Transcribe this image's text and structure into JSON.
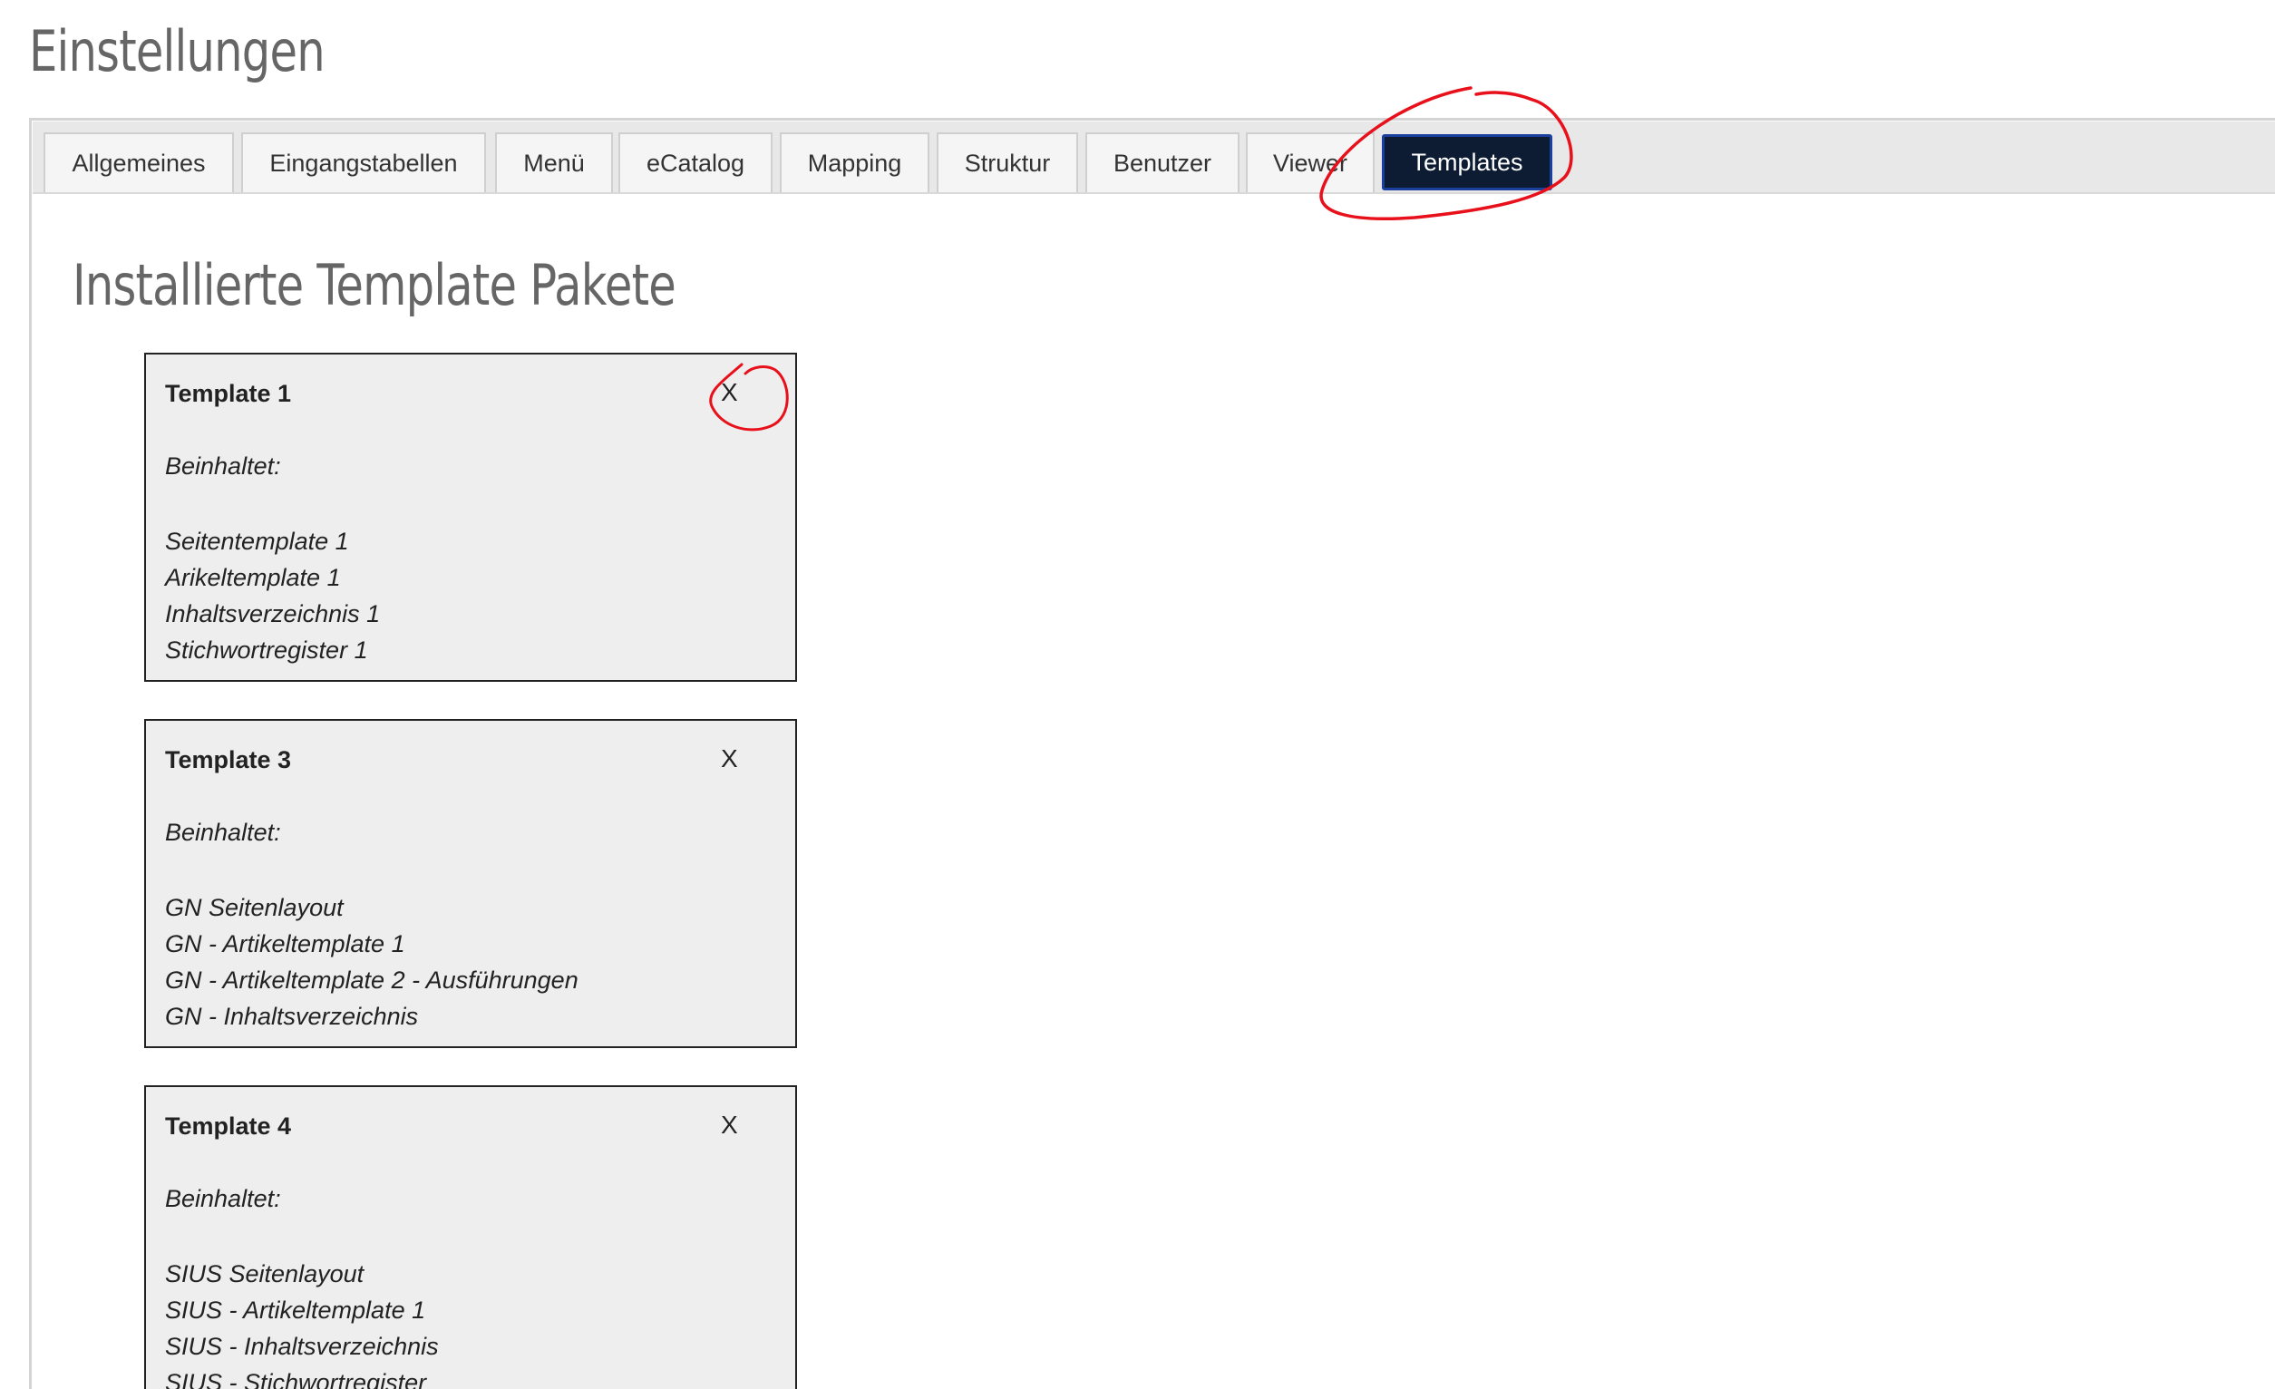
{
  "page": {
    "title": "Einstellungen"
  },
  "tabs": [
    {
      "label": "Allgemeines",
      "active": false
    },
    {
      "label": "Eingangstabellen",
      "active": false
    },
    {
      "label": "Menü",
      "active": false
    },
    {
      "label": "eCatalog",
      "active": false
    },
    {
      "label": "Mapping",
      "active": false
    },
    {
      "label": "Struktur",
      "active": false
    },
    {
      "label": "Benutzer",
      "active": false
    },
    {
      "label": "Viewer",
      "active": false
    },
    {
      "label": "Templates",
      "active": true
    }
  ],
  "section": {
    "title": "Installierte Template Pakete"
  },
  "packages": [
    {
      "name": "Template 1",
      "close_label": "X",
      "contains_label": "Beinhaltet:",
      "items": [
        "Seitentemplate 1",
        "Arikeltemplate 1",
        "Inhaltsverzeichnis 1",
        "Stichwortregister 1"
      ]
    },
    {
      "name": "Template 3",
      "close_label": "X",
      "contains_label": "Beinhaltet:",
      "items": [
        "GN Seitenlayout",
        "GN - Artikeltemplate 1",
        "GN - Artikeltemplate 2 - Ausführungen",
        "GN - Inhaltsverzeichnis"
      ]
    },
    {
      "name": "Template 4",
      "close_label": "X",
      "contains_label": "Beinhaltet:",
      "items": [
        "SIUS Seitenlayout",
        "SIUS - Artikeltemplate 1",
        "SIUS - Inhaltsverzeichnis",
        "SIUS - Stichwortregister"
      ]
    }
  ],
  "colors": {
    "active_tab_bg": "#0d1b33",
    "active_tab_border": "#1a3f9c",
    "annotation": "#e8101a",
    "card_bg": "#eeeeee"
  }
}
